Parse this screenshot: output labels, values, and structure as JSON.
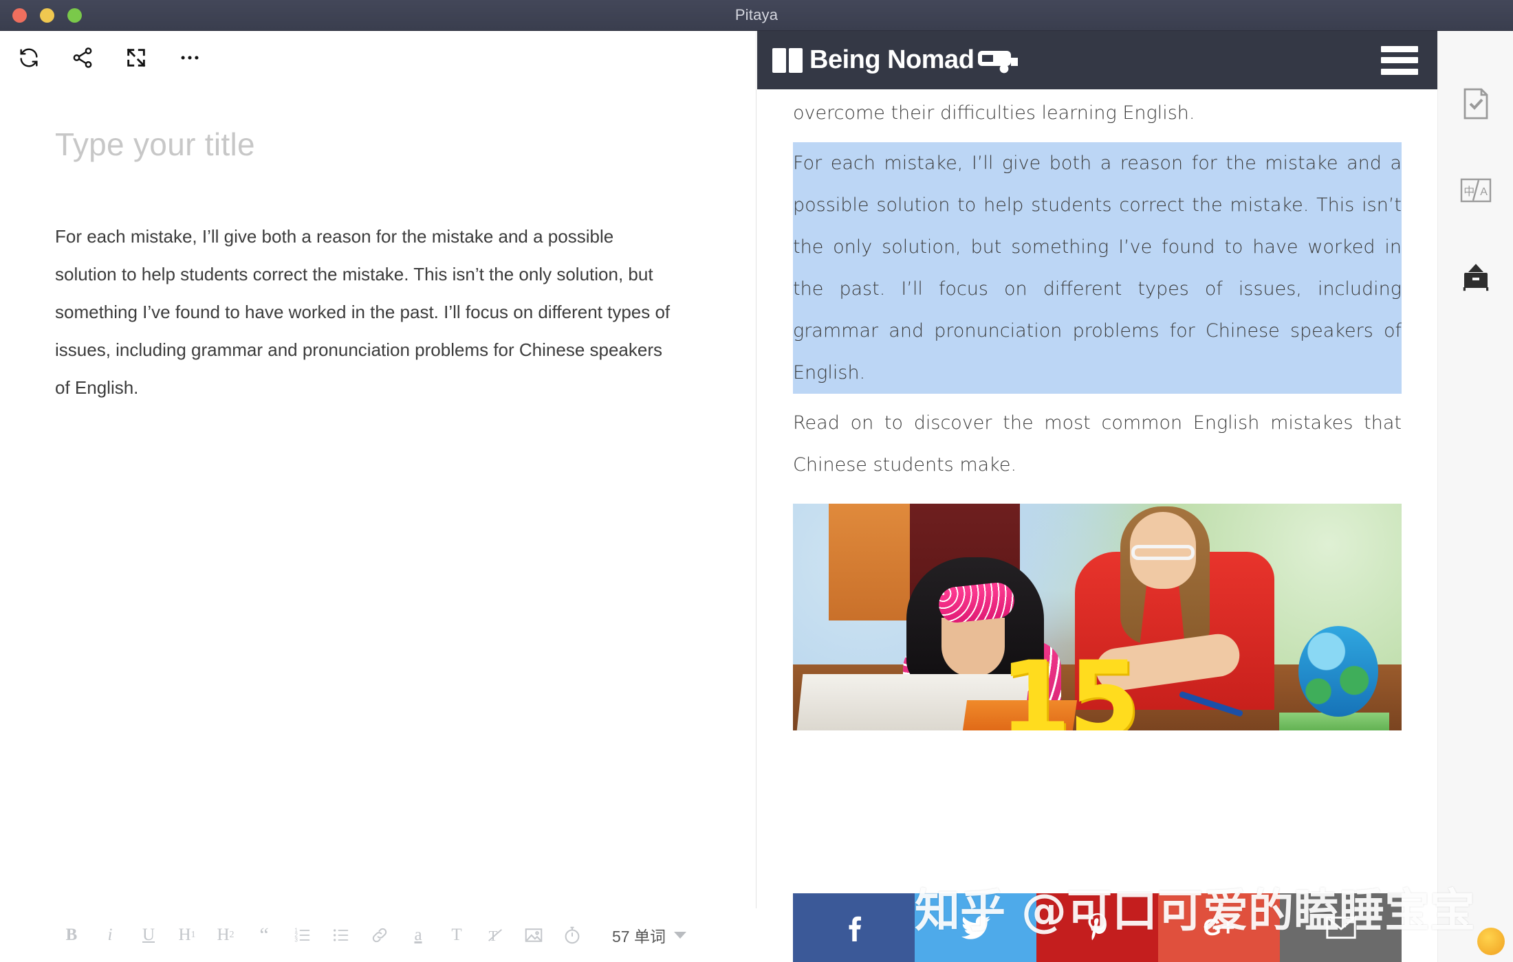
{
  "window": {
    "title": "Pitaya",
    "traffic_lights": [
      {
        "name": "close",
        "color": "#ef6f5e"
      },
      {
        "name": "minimize",
        "color": "#f0c850"
      },
      {
        "name": "maximize",
        "color": "#7ac94a"
      }
    ]
  },
  "editor": {
    "toolbar": [
      {
        "name": "refresh-icon",
        "label": "Refresh"
      },
      {
        "name": "share-icon",
        "label": "Share"
      },
      {
        "name": "fullscreen-icon",
        "label": "Fullscreen"
      },
      {
        "name": "more-icon",
        "label": "More"
      }
    ],
    "title_placeholder": "Type your title",
    "body": "For each mistake, I’ll give both a reason for the mistake and a possible solution to help students correct the mistake. This isn’t the only solution, but something I’ve found to have worked in the past. I’ll focus on different types of issues, including grammar and pronunciation problems for Chinese speakers of English.",
    "format_buttons": [
      {
        "name": "bold-button",
        "label": "B"
      },
      {
        "name": "italic-button",
        "label": "i"
      },
      {
        "name": "underline-button",
        "label": "U"
      },
      {
        "name": "heading1-button",
        "label": "H1"
      },
      {
        "name": "heading2-button",
        "label": "H2"
      },
      {
        "name": "blockquote-button",
        "label": "“"
      },
      {
        "name": "ordered-list-button",
        "label": "list-ordered"
      },
      {
        "name": "unordered-list-button",
        "label": "list-bullet"
      },
      {
        "name": "link-button",
        "label": "link"
      },
      {
        "name": "highlight-button",
        "label": "a"
      },
      {
        "name": "text-style-button",
        "label": "T"
      },
      {
        "name": "clear-format-button",
        "label": "clear"
      },
      {
        "name": "image-button",
        "label": "image"
      },
      {
        "name": "timer-button",
        "label": "timer"
      }
    ],
    "word_count": "57 单词"
  },
  "preview": {
    "site_logo": "Being Nomad",
    "menu_label": "menu",
    "paragraphs": [
      {
        "name": "paragraph-intro",
        "text": "…to Chinese students. But students can use it well to help them overcome their difficulties learning English.",
        "selected": false
      },
      {
        "name": "paragraph-selected",
        "text": "For each mistake, I’ll give both a reason for the mistake and a possible solution to help students correct the mistake. This isn’t the only solution, but something I’ve found to have worked in the past. I’ll focus on different types of issues, including grammar and pronunciation problems for Chinese speakers of English.",
        "selected": true
      },
      {
        "name": "paragraph-readon",
        "text": "Read on to discover the most common English mistakes that Chinese students make.",
        "selected": false
      }
    ],
    "photo": {
      "name": "article-photo",
      "alt": "teacher helping a student with homework",
      "overlay_number": "15"
    },
    "social_buttons": [
      {
        "name": "share-facebook-button",
        "glyph": "f",
        "color": "#3b5998"
      },
      {
        "name": "share-twitter-button",
        "glyph": "🐦",
        "color": "#4eaaea"
      },
      {
        "name": "share-pinterest-button",
        "glyph": "℗",
        "color": "#c41e1e"
      },
      {
        "name": "share-googleplus-button",
        "glyph": "G+",
        "color": "#e0503d"
      },
      {
        "name": "share-email-button",
        "glyph": "✉",
        "color": "#6b6b6b"
      }
    ]
  },
  "sidebar": {
    "items": [
      {
        "name": "sidebar-item-check-document",
        "icon": "document-check-icon"
      },
      {
        "name": "sidebar-item-translate",
        "icon": "translate-icon"
      },
      {
        "name": "sidebar-item-archive",
        "icon": "archive-icon"
      }
    ]
  },
  "watermark": {
    "text": "知乎 @可口可爱的瞌睡宝宝"
  },
  "colors": {
    "titlebar": "#3a3e4e",
    "preview_topbar": "#343845",
    "selection": "#bcd6f5",
    "sidebar_bg": "#f7f7f7"
  }
}
